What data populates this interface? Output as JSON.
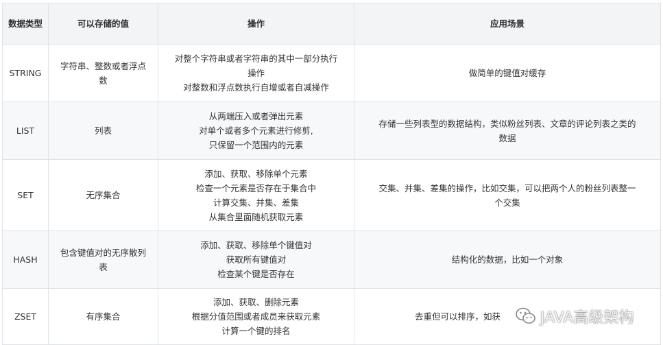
{
  "table": {
    "headers": [
      "数据类型",
      "可以存储的值",
      "操作",
      "应用场景"
    ],
    "rows": [
      {
        "type": "STRING",
        "value": [
          "字符串、整数或者浮点",
          "数"
        ],
        "ops": [
          "对整个字符串或者字符串的其中一部分执行",
          "操作",
          "对整数和浮点数执行自增或者自减操作"
        ],
        "scenario": [
          "做简单的键值对缓存"
        ]
      },
      {
        "type": "LIST",
        "value": [
          "列表"
        ],
        "ops": [
          "从两端压入或者弹出元素",
          "对单个或者多个元素进行修剪,",
          "只保留一个范围内的元素"
        ],
        "scenario": [
          "存储一些列表型的数据结构，类似粉丝列表、文章的评论列表之类的",
          "数据"
        ]
      },
      {
        "type": "SET",
        "value": [
          "无序集合"
        ],
        "ops": [
          "添加、获取、移除单个元素",
          "检查一个元素是否存在于集合中",
          "计算交集、并集、差集",
          "从集合里面随机获取元素"
        ],
        "scenario": [
          "交集、并集、差集的操作，比如交集，可以把两个人的粉丝列表整一",
          "个交集"
        ]
      },
      {
        "type": "HASH",
        "value": [
          "包含键值对的无序散列",
          "表"
        ],
        "ops": [
          "添加、获取、移除单个键值对",
          "获取所有键值对",
          "检查某个键是否存在"
        ],
        "scenario": [
          "结构化的数据，比如一个对象"
        ]
      },
      {
        "type": "ZSET",
        "value": [
          "有序集合"
        ],
        "ops": [
          "添加、获取、删除元素",
          "根据分值范围或者成员来获取元素",
          "计算一个键的排名"
        ],
        "scenario": [
          "去重但可以排序，如获"
        ]
      }
    ]
  },
  "watermark": {
    "text": "JAVA高级架构",
    "icon": "wechat-icon"
  }
}
